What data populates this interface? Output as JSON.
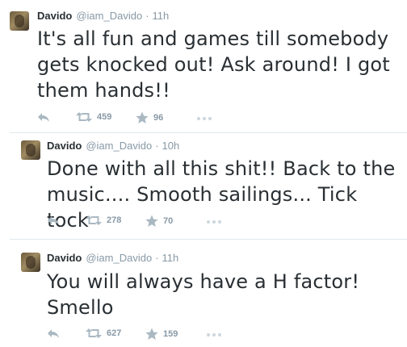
{
  "tweets": [
    {
      "name": "Davido",
      "handle": "@iam_Davido",
      "separator": "·",
      "time": "11h",
      "text": "It's all fun and games till somebody gets knocked out! Ask around! I got them hands!!",
      "retweets": "459",
      "favorites": "96"
    },
    {
      "name": "Davido",
      "handle": "@iam_Davido",
      "separator": "·",
      "time": "10h",
      "text": "Done with all this shit!! Back to the music.... Smooth sailings... Tick tock",
      "retweets": "278",
      "favorites": "70"
    },
    {
      "name": "Davido",
      "handle": "@iam_Davido",
      "separator": "·",
      "time": "11h",
      "text": "You will always have a H factor! Smello",
      "retweets": "627",
      "favorites": "159"
    }
  ],
  "colors": {
    "icon": "#aab8c2",
    "muted": "#8899a6",
    "text": "#292f33",
    "divider": "#e1e8ed"
  },
  "icons": {
    "reply": "reply-icon",
    "retweet": "retweet-icon",
    "favorite": "star-icon",
    "more": "more-dots-icon"
  }
}
